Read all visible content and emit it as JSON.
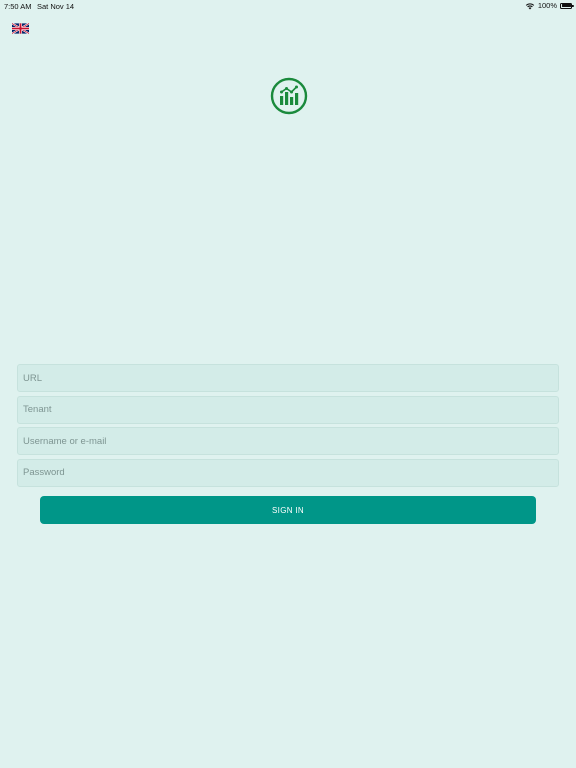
{
  "status_bar": {
    "time": "7:50 AM",
    "date": "Sat Nov 14",
    "battery": "100%",
    "battery_level": 1.0,
    "icons": [
      "wifi-icon",
      "battery-icon"
    ]
  },
  "language": {
    "icon": "uk-flag-icon"
  },
  "app": {
    "logo_icon": "chart-logo-icon",
    "brand_color": "#1a8a3c"
  },
  "form": {
    "url_placeholder": "URL",
    "url_value": "",
    "tenant_placeholder": "Tenant",
    "tenant_value": "",
    "username_placeholder": "Username or e-mail",
    "username_value": "",
    "password_placeholder": "Password",
    "password_value": "",
    "signin_label": "SIGN IN"
  },
  "colors": {
    "background": "#dff2ef",
    "field_background": "#d3ece8",
    "accent": "#009688"
  }
}
